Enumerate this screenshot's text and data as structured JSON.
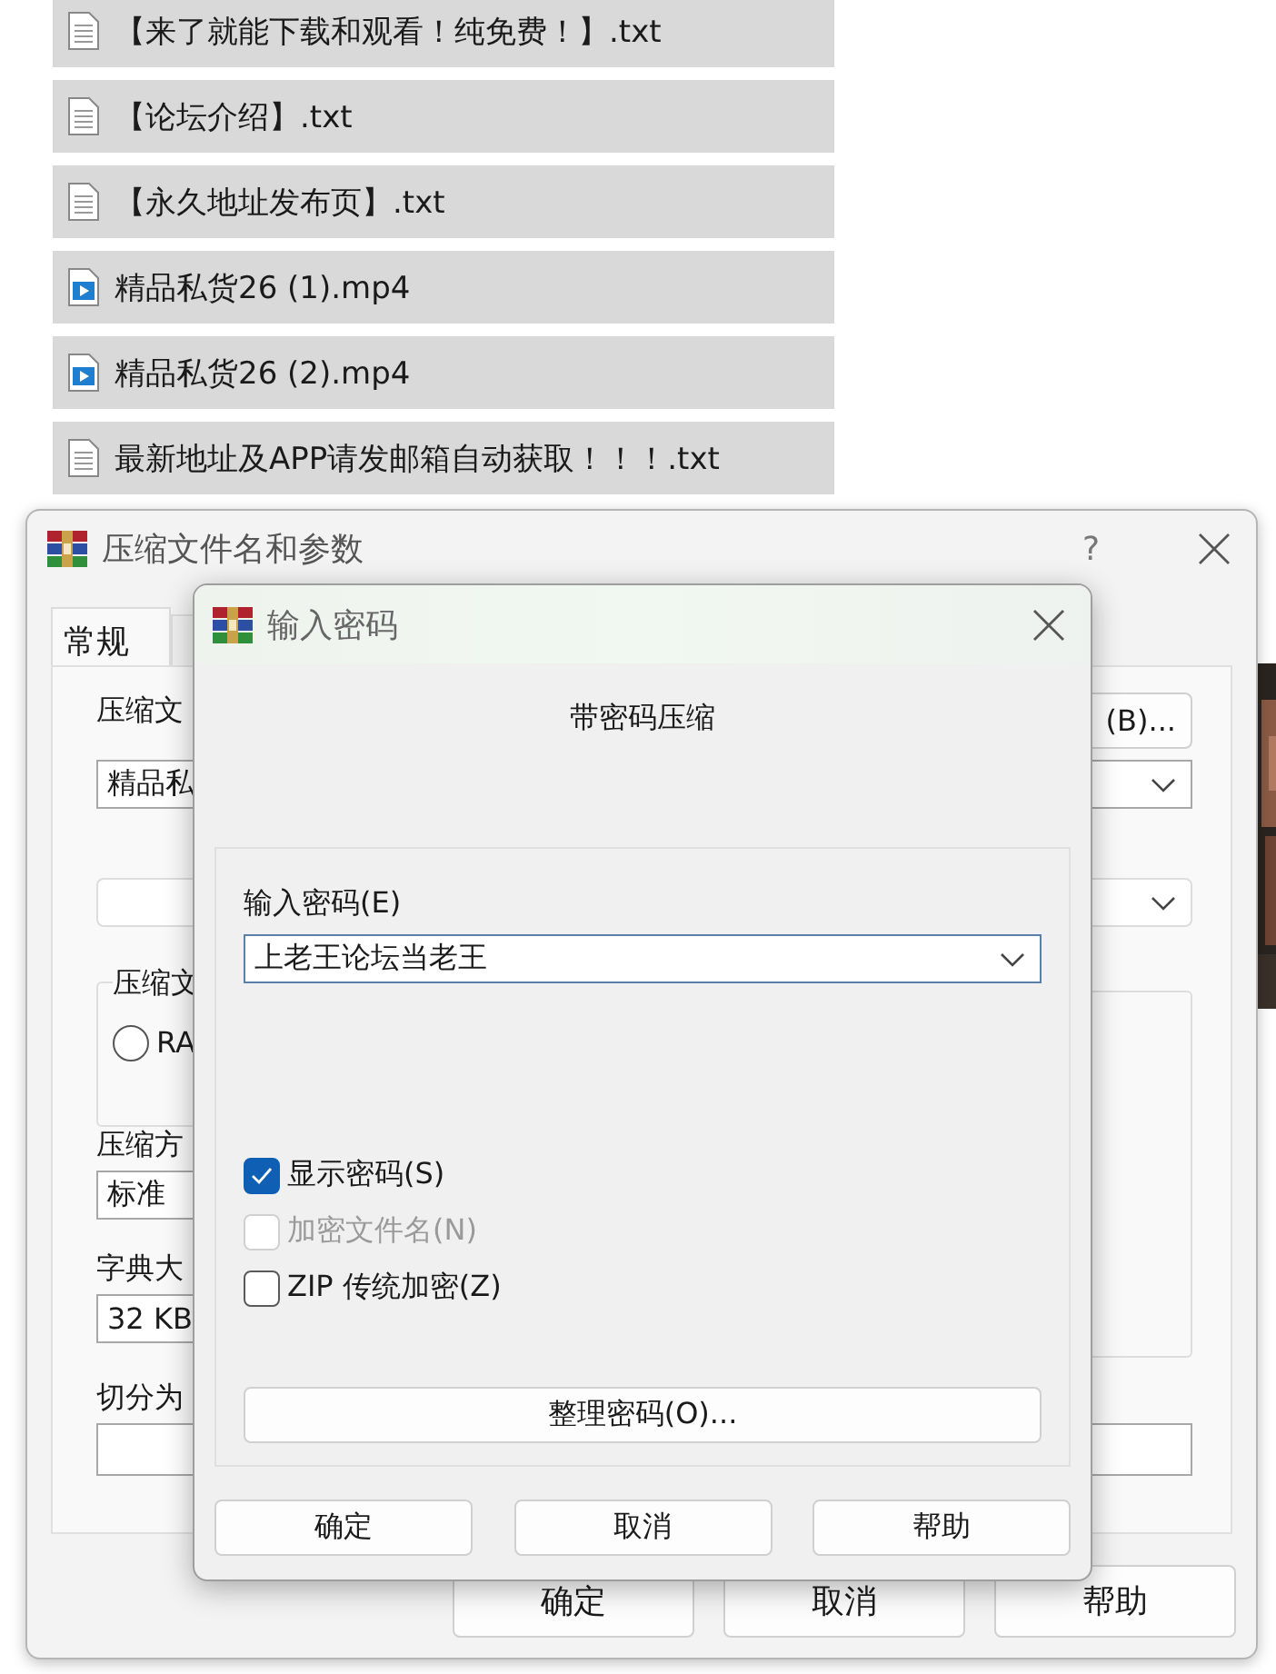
{
  "file_list": [
    {
      "name": "【来了就能下载和观看！纯免费！】.txt",
      "kind": "text"
    },
    {
      "name": "【论坛介绍】.txt",
      "kind": "text"
    },
    {
      "name": "【永久地址发布页】.txt",
      "kind": "text"
    },
    {
      "name": "精品私货26 (1).mp4",
      "kind": "video"
    },
    {
      "name": "精品私货26 (2).mp4",
      "kind": "video"
    },
    {
      "name": "最新地址及APP请发邮箱自动获取！！！.txt",
      "kind": "text"
    }
  ],
  "back_dialog": {
    "title": "压缩文件名和参数",
    "help": "?",
    "tabs": [
      {
        "label": "常规",
        "selected": true
      },
      {
        "selected": false
      }
    ],
    "archive_label": "压缩文",
    "browse_button": "(B)...",
    "archive_name": "精品私",
    "format_group": "压缩文",
    "format_option": {
      "label": "RA",
      "selected": false
    },
    "method_label": "压缩方",
    "method_value": "标准",
    "dict_label": "字典大",
    "dict_value": "32 KB",
    "split_label": "切分为",
    "buttons": [
      "确定",
      "取消",
      "帮助"
    ]
  },
  "password_dialog": {
    "title": "输入密码",
    "heading": "带密码压缩",
    "password_label": "输入密码(E)",
    "password_value": "上老王论坛当老王",
    "options": [
      {
        "label": "显示密码(S)",
        "checked": true,
        "disabled": false
      },
      {
        "label": "加密文件名(N)",
        "checked": false,
        "disabled": true
      },
      {
        "label": "ZIP 传统加密(Z)",
        "checked": false,
        "disabled": false
      }
    ],
    "organize_button": "整理密码(O)...",
    "buttons": [
      "确定",
      "取消",
      "帮助"
    ]
  }
}
